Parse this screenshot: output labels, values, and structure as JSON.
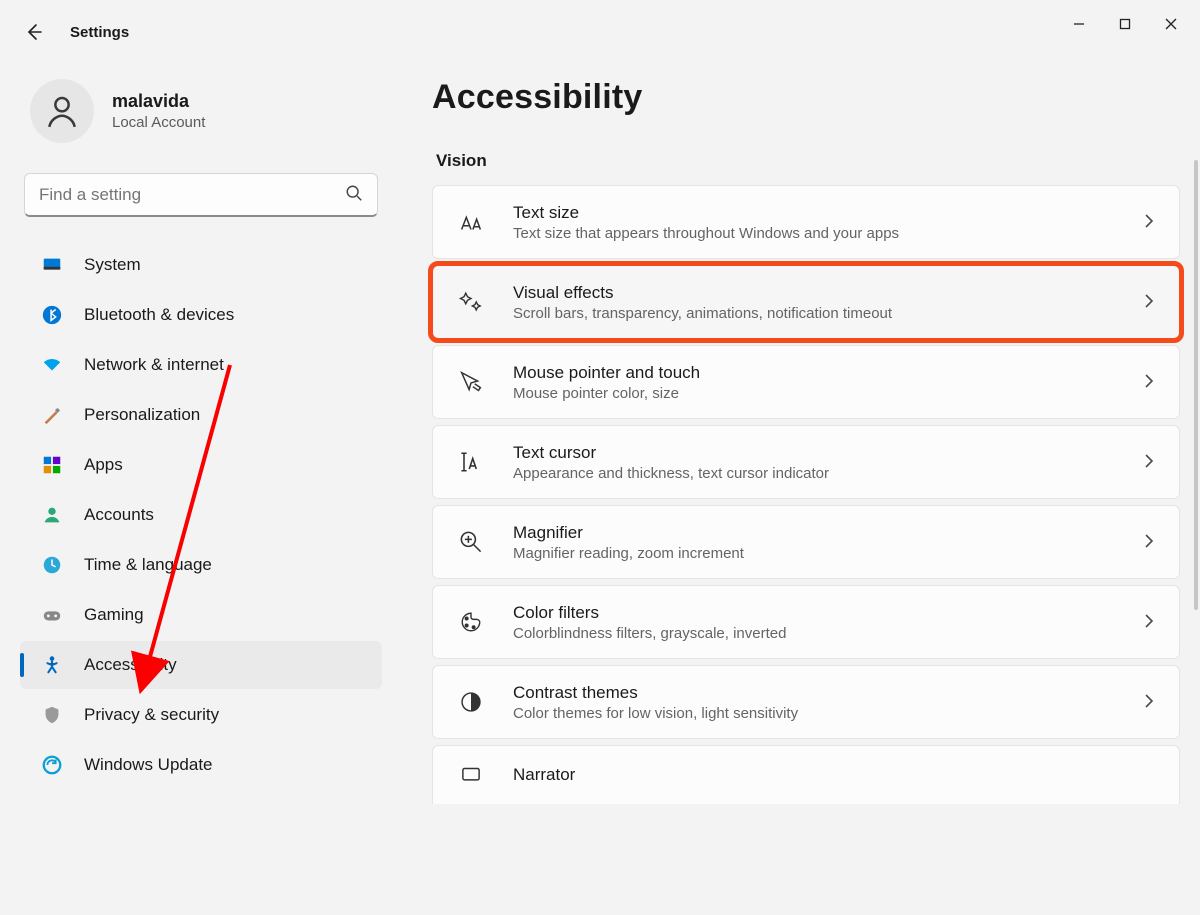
{
  "app": {
    "title": "Settings"
  },
  "user": {
    "name": "malavida",
    "subtitle": "Local Account"
  },
  "search": {
    "placeholder": "Find a setting"
  },
  "sidebar": {
    "items": [
      {
        "label": "System"
      },
      {
        "label": "Bluetooth & devices"
      },
      {
        "label": "Network & internet"
      },
      {
        "label": "Personalization"
      },
      {
        "label": "Apps"
      },
      {
        "label": "Accounts"
      },
      {
        "label": "Time & language"
      },
      {
        "label": "Gaming"
      },
      {
        "label": "Accessibility",
        "selected": true
      },
      {
        "label": "Privacy & security"
      },
      {
        "label": "Windows Update"
      }
    ]
  },
  "page": {
    "heading": "Accessibility",
    "section": "Vision",
    "cards": [
      {
        "title": "Text size",
        "sub": "Text size that appears throughout Windows and your apps"
      },
      {
        "title": "Visual effects",
        "sub": "Scroll bars, transparency, animations, notification timeout",
        "highlight": true
      },
      {
        "title": "Mouse pointer and touch",
        "sub": "Mouse pointer color, size"
      },
      {
        "title": "Text cursor",
        "sub": "Appearance and thickness, text cursor indicator"
      },
      {
        "title": "Magnifier",
        "sub": "Magnifier reading, zoom increment"
      },
      {
        "title": "Color filters",
        "sub": "Colorblindness filters, grayscale, inverted"
      },
      {
        "title": "Contrast themes",
        "sub": "Color themes for low vision, light sensitivity"
      },
      {
        "title": "Narrator",
        "sub": ""
      }
    ]
  }
}
